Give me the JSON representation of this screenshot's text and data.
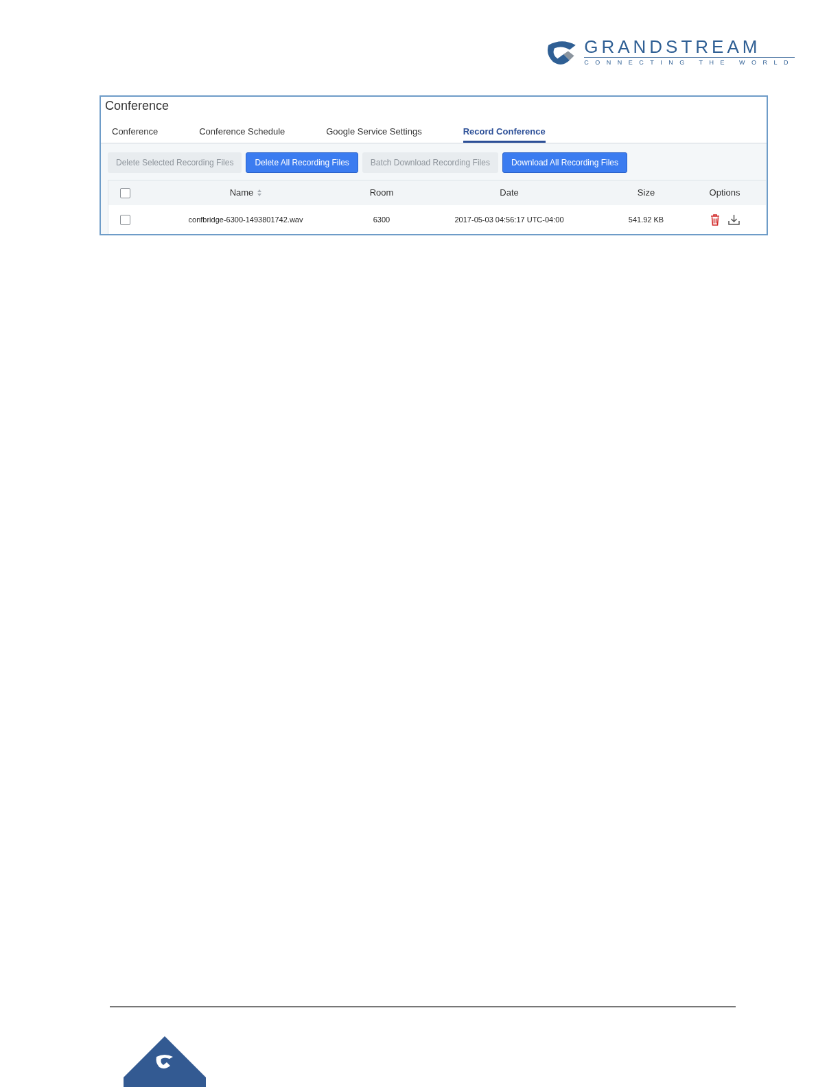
{
  "logo": {
    "name": "GRANDSTREAM",
    "tagline": "CONNECTING THE WORLD"
  },
  "panel": {
    "title": "Conference",
    "tabs": [
      {
        "label": "Conference",
        "selected": false
      },
      {
        "label": "Conference Schedule",
        "selected": false
      },
      {
        "label": "Google Service Settings",
        "selected": false
      },
      {
        "label": "Record Conference",
        "selected": true
      }
    ],
    "buttons": [
      {
        "label": "Delete Selected Recording Files",
        "disabled": true
      },
      {
        "label": "Delete All Recording Files",
        "disabled": false
      },
      {
        "label": "Batch Download Recording Files",
        "disabled": true
      },
      {
        "label": "Download All Recording Files",
        "disabled": false
      }
    ],
    "table": {
      "select_all": {
        "checked": false
      },
      "columns": [
        {
          "label": "Name",
          "sortable": true
        },
        {
          "label": "Room",
          "sortable": false
        },
        {
          "label": "Date",
          "sortable": false
        },
        {
          "label": "Size",
          "sortable": false
        },
        {
          "label": "Options",
          "sortable": false
        }
      ],
      "rows": [
        {
          "checked": false,
          "name": "confbridge-6300-1493801742.wav",
          "room": "6300",
          "date": "2017-05-03 04:56:17 UTC-04:00",
          "size": "541.92 KB"
        }
      ]
    }
  }
}
